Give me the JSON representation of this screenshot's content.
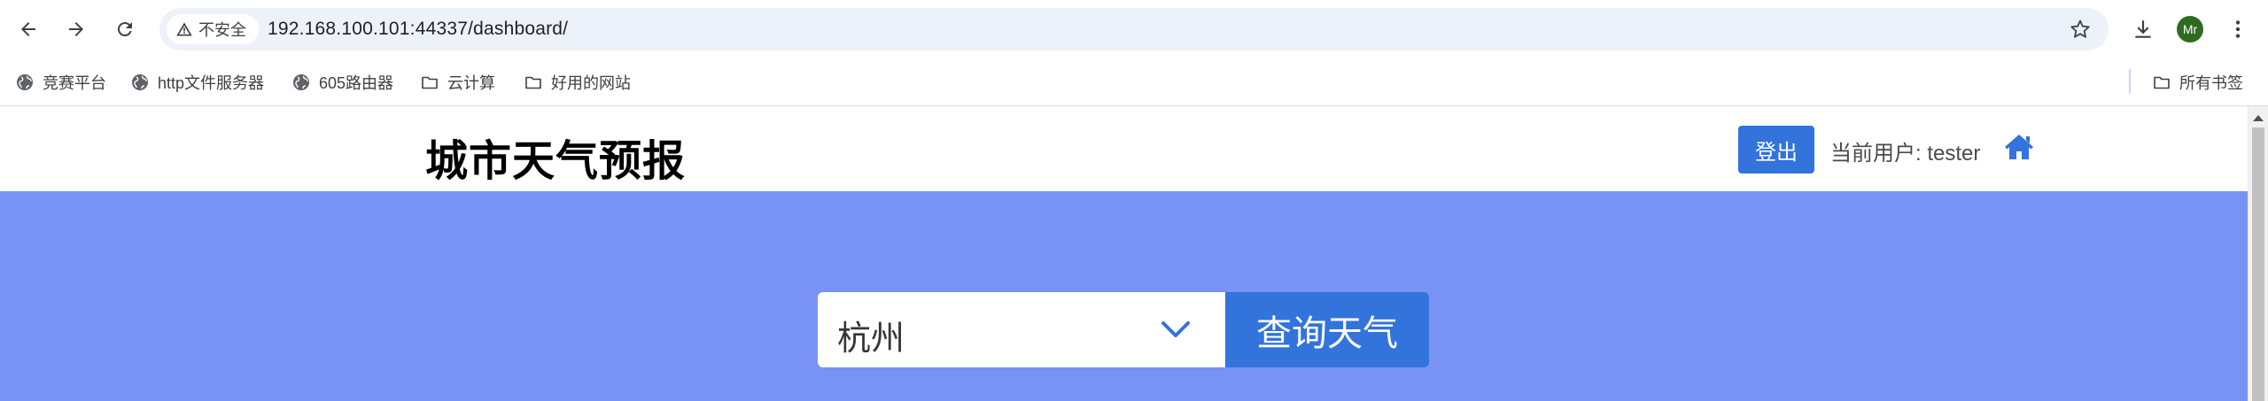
{
  "browser": {
    "security_label": "不安全",
    "url": "192.168.100.101:44337/dashboard/",
    "profile_initials": "Mr"
  },
  "bookmarks": {
    "items": [
      {
        "label": "竞赛平台",
        "icon": "globe-icon"
      },
      {
        "label": "http文件服务器",
        "icon": "globe-icon"
      },
      {
        "label": "605路由器",
        "icon": "globe-icon"
      },
      {
        "label": "云计算",
        "icon": "folder-icon"
      },
      {
        "label": "好用的网站",
        "icon": "folder-icon"
      }
    ],
    "all_bookmarks_label": "所有书签"
  },
  "header": {
    "title": "城市天气预报",
    "logout_label": "登出",
    "current_user_text": "当前用户: tester"
  },
  "search": {
    "selected_city": "杭州",
    "submit_label": "查询天气"
  },
  "colors": {
    "primary": "#3273dc",
    "hero_background": "#7893f4",
    "omnibox_background": "#edf2fa",
    "profile_avatar": "#2e6b1f"
  }
}
